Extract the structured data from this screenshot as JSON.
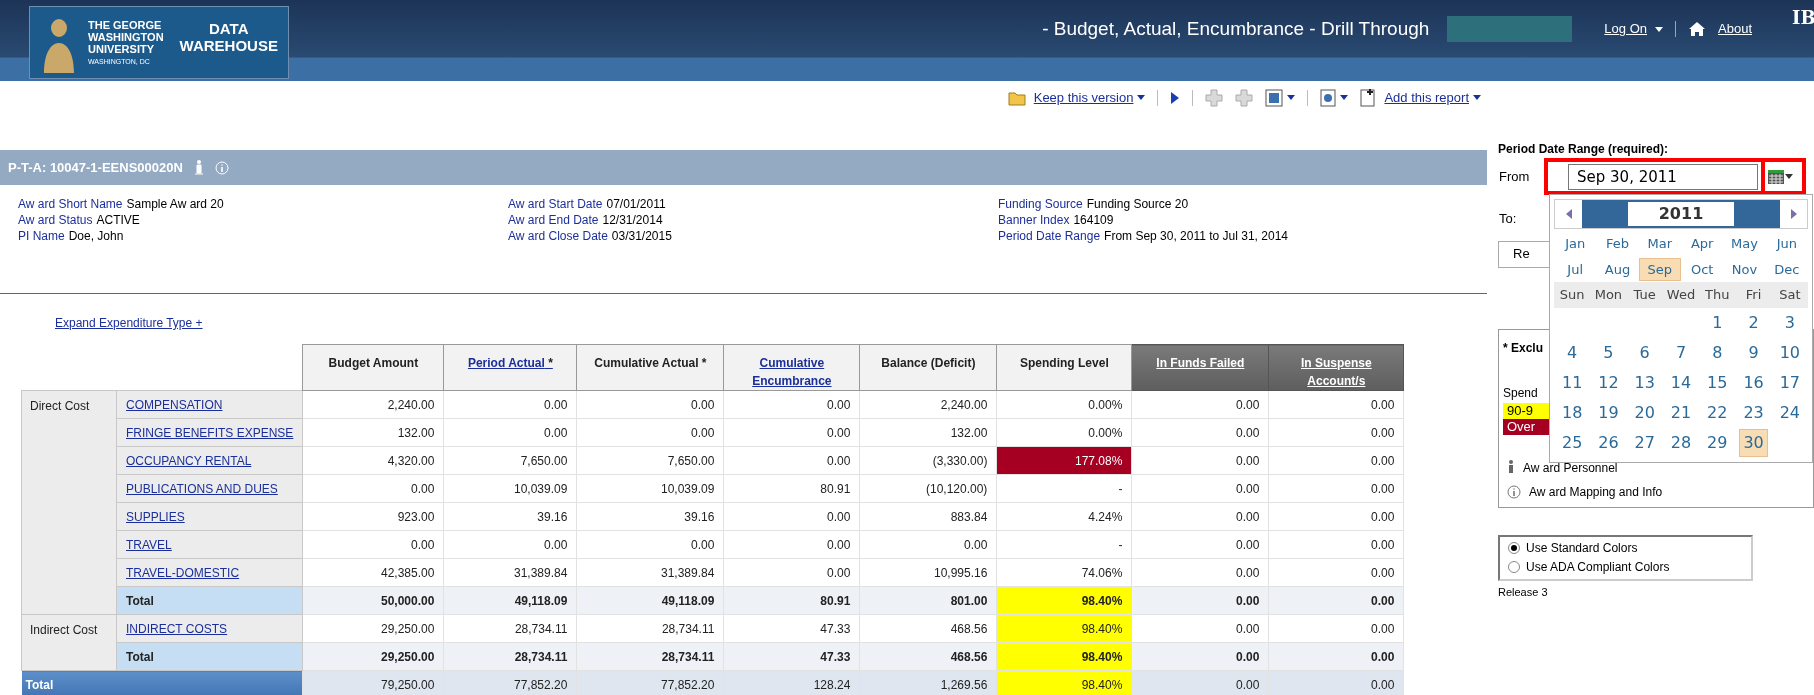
{
  "header": {
    "logo_lines": [
      "THE GEORGE",
      "WASHINGTON",
      "UNIVERSITY"
    ],
    "logo_place": "WASHINGTON, DC",
    "logo_title": [
      "DATA",
      "WAREHOUSE"
    ],
    "report_title": "- Budget, Actual, Encumbrance - Drill Through",
    "log_on": "Log On",
    "about": "About",
    "corner_text": "IB"
  },
  "toolbar": {
    "keep_version": "Keep this version",
    "add_report": "Add this report"
  },
  "award": {
    "title": "P-T-A: 10047-1-EENS00020N",
    "columns": [
      [
        {
          "label": "Aw ard Short Name",
          "value": "Sample Aw ard 20"
        },
        {
          "label": "Aw ard Status",
          "value": "ACTIVE"
        },
        {
          "label": "PI Name",
          "value": "Doe, John"
        }
      ],
      [
        {
          "label": "Aw ard Start Date",
          "value": "07/01/2011"
        },
        {
          "label": "Aw ard End Date",
          "value": "12/31/2014"
        },
        {
          "label": "Aw ard Close Date",
          "value": "03/31/2015"
        }
      ],
      [
        {
          "label": "Funding Source",
          "value": "Funding Source 20"
        },
        {
          "label": "Banner Index",
          "value": "164109"
        },
        {
          "label": "Period Date Range",
          "value": "From Sep 30, 2011 to Jul 31, 2014"
        }
      ]
    ]
  },
  "expand_link": "Expand Expenditure Type +",
  "table": {
    "columns": [
      {
        "label": "Budget Amount",
        "kind": "plain"
      },
      {
        "label": "Period Actual",
        "note": " *",
        "kind": "link"
      },
      {
        "label": "Cumulative Actual",
        "note": " *",
        "kind": "plain"
      },
      {
        "label": "Cumulative Encumbrance",
        "kind": "link"
      },
      {
        "label": "Balance (Deficit)",
        "kind": "plain"
      },
      {
        "label": "Spending Level",
        "kind": "plain"
      },
      {
        "label": "In Funds Failed",
        "kind": "dark"
      },
      {
        "label": "In Suspense Account/s",
        "kind": "dark"
      }
    ],
    "groups": [
      {
        "name": "Direct Cost",
        "rows": [
          {
            "category": "COMPENSATION",
            "values": [
              "2,240.00",
              "0.00",
              "0.00",
              "0.00",
              "2,240.00",
              "0.00%",
              "0.00",
              "0.00"
            ]
          },
          {
            "category": "FRINGE BENEFITS EXPENSE",
            "values": [
              "132.00",
              "0.00",
              "0.00",
              "0.00",
              "132.00",
              "0.00%",
              "0.00",
              "0.00"
            ]
          },
          {
            "category": "OCCUPANCY RENTAL",
            "values": [
              "4,320.00",
              "7,650.00",
              "7,650.00",
              "0.00",
              "(3,330.00)",
              "177.08%",
              "0.00",
              "0.00"
            ],
            "color": "#a50021"
          },
          {
            "category": "PUBLICATIONS AND DUES",
            "values": [
              "0.00",
              "10,039.09",
              "10,039.09",
              "80.91",
              "(10,120.00)",
              "-",
              "0.00",
              "0.00"
            ]
          },
          {
            "category": "SUPPLIES",
            "values": [
              "923.00",
              "39.16",
              "39.16",
              "0.00",
              "883.84",
              "4.24%",
              "0.00",
              "0.00"
            ]
          },
          {
            "category": "TRAVEL",
            "values": [
              "0.00",
              "0.00",
              "0.00",
              "0.00",
              "0.00",
              "-",
              "0.00",
              "0.00"
            ]
          },
          {
            "category": "TRAVEL-DOMESTIC",
            "values": [
              "42,385.00",
              "31,389.84",
              "31,389.84",
              "0.00",
              "10,995.16",
              "74.06%",
              "0.00",
              "0.00"
            ]
          }
        ],
        "total": {
          "label": "Total",
          "values": [
            "50,000.00",
            "49,118.09",
            "49,118.09",
            "80.91",
            "801.00",
            "98.40%",
            "0.00",
            "0.00"
          ],
          "color": "#ffff00"
        }
      },
      {
        "name": "Indirect Cost",
        "rows": [
          {
            "category": "INDIRECT COSTS",
            "values": [
              "29,250.00",
              "28,734.11",
              "28,734.11",
              "47.33",
              "468.56",
              "98.40%",
              "0.00",
              "0.00"
            ],
            "color": "#ffff00"
          }
        ],
        "total": {
          "label": "Total",
          "values": [
            "29,250.00",
            "28,734.11",
            "28,734.11",
            "47.33",
            "468.56",
            "98.40%",
            "0.00",
            "0.00"
          ],
          "color": "#ffff00"
        }
      }
    ],
    "grand_total": {
      "label": "Total",
      "values": [
        "79,250.00",
        "77,852.20",
        "77,852.20",
        "128.24",
        "1,269.56",
        "98.40%",
        "0.00",
        "0.00"
      ],
      "color": "#ffff00"
    }
  },
  "prompt": {
    "label": "Period Date Range (required):",
    "from_label": "From",
    "from_value": "Sep 30, 2011",
    "to_label": "To:",
    "run_button": "Re"
  },
  "legend": {
    "title": "* Exclu",
    "spend_label": "Spend",
    "items": [
      {
        "text": "90-9",
        "color": "#ffff00"
      },
      {
        "text": "Over",
        "color": "#a50021"
      }
    ],
    "links": [
      "Aw ard Personnel",
      "Aw ard Mapping and Info"
    ]
  },
  "color_options": [
    {
      "label": "Use Standard Colors",
      "selected": true
    },
    {
      "label": "Use ADA Compliant Colors",
      "selected": false
    }
  ],
  "release": "Release 3",
  "calendar": {
    "year": "2011",
    "months": [
      {
        "label": "Jan",
        "selected": false
      },
      {
        "label": "Feb",
        "selected": false
      },
      {
        "label": "Mar",
        "selected": false
      },
      {
        "label": "Apr",
        "selected": false
      },
      {
        "label": "May",
        "selected": false
      },
      {
        "label": "Jun",
        "selected": false
      },
      {
        "label": "Jul",
        "selected": false
      },
      {
        "label": "Aug",
        "selected": false
      },
      {
        "label": "Sep",
        "selected": true
      },
      {
        "label": "Oct",
        "selected": false
      },
      {
        "label": "Nov",
        "selected": false
      },
      {
        "label": "Dec",
        "selected": false
      }
    ],
    "weekdays": [
      "Sun",
      "Mon",
      "Tue",
      "Wed",
      "Thu",
      "Fri",
      "Sat"
    ],
    "weeks": [
      {
        "kind": "opening",
        "days": [
          {
            "label": "1",
            "selected": false
          },
          {
            "label": "2",
            "selected": false
          },
          {
            "label": "3",
            "selected": false
          }
        ]
      },
      {
        "kind": "regular",
        "days": [
          {
            "label": "4",
            "selected": false
          },
          {
            "label": "5",
            "selected": false
          },
          {
            "label": "6",
            "selected": false
          },
          {
            "label": "7",
            "selected": false
          },
          {
            "label": "8",
            "selected": false
          },
          {
            "label": "9",
            "selected": false
          },
          {
            "label": "10",
            "selected": false
          }
        ]
      },
      {
        "kind": "regular",
        "days": [
          {
            "label": "11",
            "selected": false
          },
          {
            "label": "12",
            "selected": false
          },
          {
            "label": "13",
            "selected": false
          },
          {
            "label": "14",
            "selected": false
          },
          {
            "label": "15",
            "selected": false
          },
          {
            "label": "16",
            "selected": false
          },
          {
            "label": "17",
            "selected": false
          }
        ]
      },
      {
        "kind": "regular",
        "days": [
          {
            "label": "18",
            "selected": false
          },
          {
            "label": "19",
            "selected": false
          },
          {
            "label": "20",
            "selected": false
          },
          {
            "label": "21",
            "selected": false
          },
          {
            "label": "22",
            "selected": false
          },
          {
            "label": "23",
            "selected": false
          },
          {
            "label": "24",
            "selected": false
          }
        ]
      },
      {
        "kind": "regular",
        "days": [
          {
            "label": "25",
            "selected": false
          },
          {
            "label": "26",
            "selected": false
          },
          {
            "label": "27",
            "selected": false
          },
          {
            "label": "28",
            "selected": false
          },
          {
            "label": "29",
            "selected": false
          },
          {
            "label": "30",
            "selected": true
          }
        ]
      }
    ]
  }
}
